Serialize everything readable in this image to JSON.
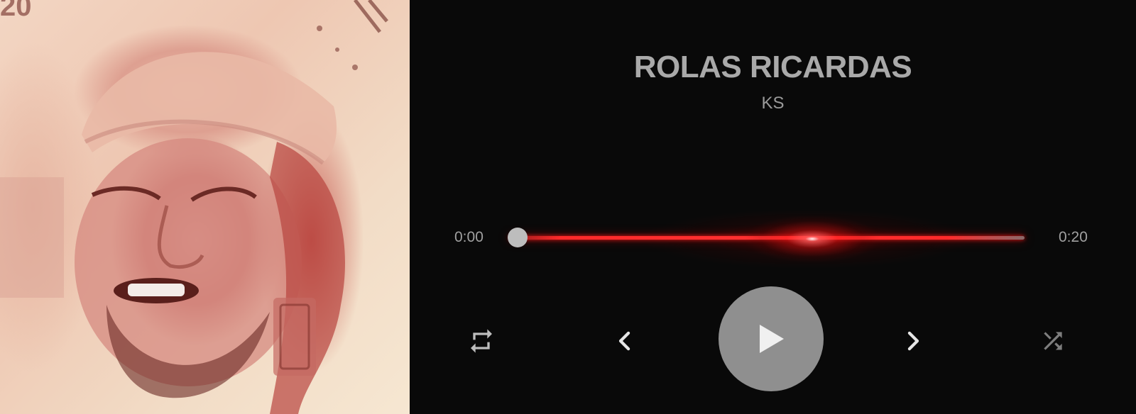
{
  "album_art": {
    "icon": "portrait-artwork-image"
  },
  "track": {
    "title": "ROLAS RICARDAS",
    "artist": "KS"
  },
  "progress": {
    "elapsed": "0:00",
    "total": "0:20",
    "fraction": 0.0
  },
  "controls": {
    "repeat_icon": "repeat-icon",
    "prev_icon": "chevron-left-icon",
    "play_icon": "play-icon",
    "next_icon": "chevron-right-icon",
    "shuffle_icon": "shuffle-icon"
  },
  "colors": {
    "background": "#090909",
    "accent": "#ff2a2a",
    "text": "#a9a9a9",
    "play_button": "#8f8f8f"
  }
}
